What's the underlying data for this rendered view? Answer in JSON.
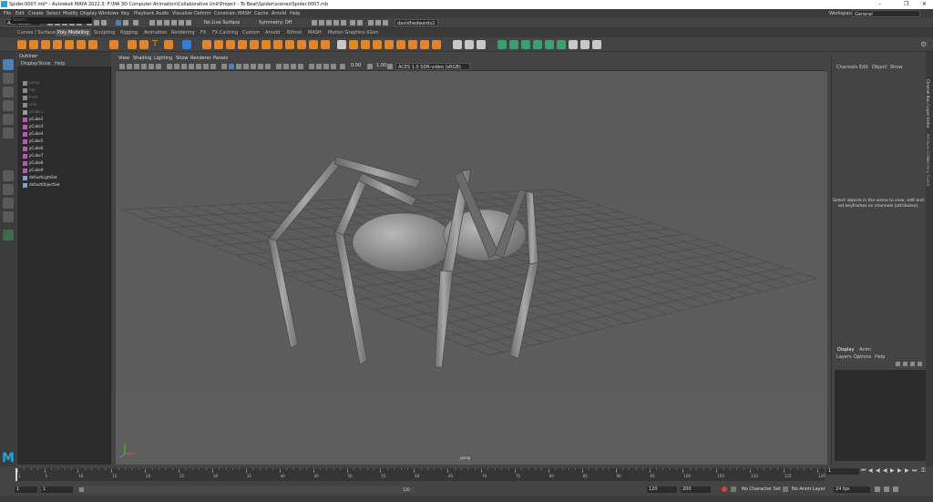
{
  "window": {
    "title": "Spider.0007.mb* - Autodesk MAYA 2022.3: F:\\MA 3D Computer Animation\\Collaborative Unit\\Project - To Beat\\Spider\\scenes\\Spider.0007.mb",
    "controls": [
      "–",
      "❐",
      "✕"
    ]
  },
  "menubar": {
    "items": [
      "File",
      "Edit",
      "Create",
      "Select",
      "Modify",
      "Display",
      "Windows",
      "Key",
      "Playback",
      "Audio",
      "Visualize",
      "Deform",
      "Constrain",
      "MASH",
      "Cache",
      "Arnold",
      "Help"
    ]
  },
  "statusline": {
    "menuset": "Animation",
    "live_surface": "No Live Surface",
    "symmetry": "Symmetry: Off",
    "user": "davidhedwards2",
    "workspace_label": "Workspace :",
    "workspace": "General"
  },
  "shelf": {
    "tabs": [
      "Curves / Surfaces",
      "Poly Modeling",
      "Sculpting",
      "Rigging",
      "Animation",
      "Rendering",
      "FX",
      "FX Caching",
      "Custom",
      "Arnold",
      "Bifrost",
      "MASH",
      "Motion Graphics",
      "XGen"
    ],
    "active_tab": "Poly Modeling"
  },
  "outliner": {
    "title": "Outliner",
    "menus": [
      "Display",
      "Show",
      "Help"
    ],
    "search_placeholder": "Search...",
    "items": [
      {
        "label": "persp",
        "dim": true
      },
      {
        "label": "top",
        "dim": true
      },
      {
        "label": "front",
        "dim": true
      },
      {
        "label": "side",
        "dim": true
      },
      {
        "label": "pCube1",
        "dim": true
      },
      {
        "label": "pCube2",
        "dim": false
      },
      {
        "label": "pCube3",
        "dim": false
      },
      {
        "label": "pCube4",
        "dim": false
      },
      {
        "label": "pCube5",
        "dim": false
      },
      {
        "label": "pCube6",
        "dim": false
      },
      {
        "label": "pCube7",
        "dim": false
      },
      {
        "label": "pCube8",
        "dim": false
      },
      {
        "label": "pCube9",
        "dim": false
      },
      {
        "label": "defaultLightSet",
        "dim": false
      },
      {
        "label": "defaultObjectSet",
        "dim": false
      }
    ]
  },
  "viewport": {
    "menus": [
      "View",
      "Shading",
      "Lighting",
      "Show",
      "Renderer",
      "Panels"
    ],
    "value_a": "0.00",
    "value_b": "1.00",
    "colorspace": "ACES 1.0 SDR-video (sRGB)",
    "camera": "persp"
  },
  "channelbox": {
    "menus": [
      "Channels",
      "Edit",
      "Object",
      "Show"
    ],
    "message": "Select objects in the scene to view, edit and set keyframes on channels (attributes)."
  },
  "layers": {
    "tabs": [
      "Display",
      "Anim"
    ],
    "menus": [
      "Layers",
      "Options",
      "Help"
    ]
  },
  "sidebar_tabs": [
    "Channel Box / Layer Editor",
    "Attribute Editor",
    "Modeling Toolkit"
  ],
  "timeline": {
    "current_frame": "1",
    "ticks": [
      "1",
      "5",
      "10",
      "15",
      "20",
      "25",
      "30",
      "35",
      "40",
      "45",
      "50",
      "55",
      "60",
      "65",
      "70",
      "75",
      "80",
      "85",
      "90",
      "95",
      "100",
      "105",
      "110",
      "115",
      "120"
    ]
  },
  "range": {
    "start": "1",
    "range_start": "1",
    "range_end": "120",
    "end": "120",
    "anim_end": "200",
    "character_set": "No Character Set",
    "anim_layer": "No Anim Layer",
    "fps": "24 fps"
  },
  "colors": {
    "accent": "#4f7fb6",
    "shelf_orange": "#e0852c",
    "maya_blue": "#1fa7d9"
  }
}
